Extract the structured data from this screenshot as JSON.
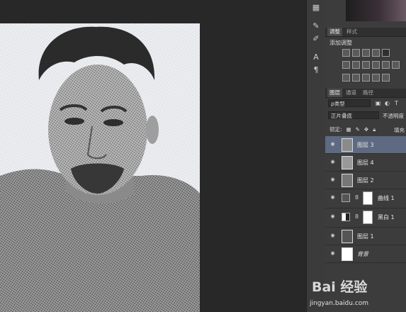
{
  "adjustments_panel": {
    "tabs": [
      "调整",
      "样式"
    ],
    "active_tab": "调整",
    "heading": "添加调整"
  },
  "layers_panel": {
    "tabs": [
      "图层",
      "通道",
      "路径"
    ],
    "active_tab": "图层",
    "filter_kind": "ρ类型",
    "blend_mode": "正片叠底",
    "opacity_label": "不透明度",
    "lock_label": "锁定:",
    "fill_label": "填充",
    "layers": [
      {
        "name": "图层 3",
        "type": "image",
        "selected": true
      },
      {
        "name": "图层 4",
        "type": "image",
        "selected": false
      },
      {
        "name": "图层 2",
        "type": "image",
        "selected": false
      },
      {
        "name": "曲线 1",
        "type": "adjustment",
        "selected": false
      },
      {
        "name": "黑白 1",
        "type": "adjustment",
        "selected": false
      },
      {
        "name": "图层 1",
        "type": "image",
        "selected": false
      },
      {
        "name": "背景",
        "type": "background",
        "selected": false
      }
    ]
  },
  "watermark": {
    "logo_text": "Bai 经验",
    "url": "jingyan.baidu.com"
  },
  "colors": {
    "selected_layer": "#5e6a82",
    "panel_bg": "#3c3c3c",
    "workspace_bg": "#282828"
  }
}
